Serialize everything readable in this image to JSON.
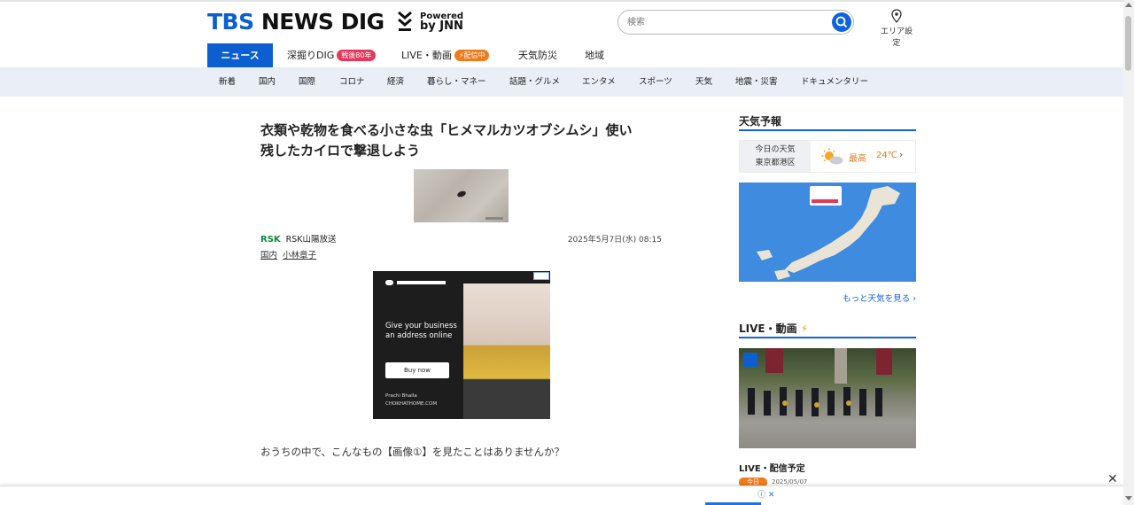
{
  "header": {
    "logo_tbs": "TBS",
    "logo_rest": " NEWS DIG",
    "powered_line1": "Powered",
    "powered_line2": "by JNN",
    "search_placeholder": "検索",
    "area_label": "エリア設定"
  },
  "nav": {
    "items": [
      {
        "label": "ニュース"
      },
      {
        "label": "深掘りDIG",
        "badge": "戦後80年"
      },
      {
        "label": "LIVE・動画",
        "badge": "配信中"
      },
      {
        "label": "天気防災"
      },
      {
        "label": "地域"
      }
    ]
  },
  "subnav": [
    "新着",
    "国内",
    "国際",
    "コロナ",
    "経済",
    "暮らし・マネー",
    "話題・グルメ",
    "エンタメ",
    "スポーツ",
    "天気",
    "地震・災害",
    "ドキュメンタリー"
  ],
  "article": {
    "title_line1": "衣類や乾物を食べる小さな虫「ヒメマルカツオブシムシ」使い",
    "title_line2": "残したカイロで撃退しよう",
    "source_logo": "RSK",
    "source_name": "RSK山陽放送",
    "date": "2025年5月7日(水) 08:15",
    "tags": [
      "国内",
      "小林章子"
    ],
    "lead": "おうちの中で、こんなもの【画像①】を見たことはありませんか？"
  },
  "ad": {
    "text_line1": "Give your business",
    "text_line2": "an address online",
    "button": "Buy now",
    "credit_name": "Prachi Bhalla",
    "credit_url": "CHOKHATHOME.COM"
  },
  "sidebar": {
    "weather_heading": "天気予報",
    "weather_today": "今日の天気",
    "weather_place": "東京都港区",
    "weather_max_label": "最高",
    "weather_max_temp": "24℃",
    "more_weather": "もっと天気を見る ›",
    "live_heading": "LIVE・動画",
    "live_schedule": "LIVE・配信予定",
    "today_badge": "今日",
    "today_date": "2025/05/07"
  },
  "colors": {
    "brand_blue": "#0b5fd1",
    "badge_red": "#e8385a",
    "badge_orange": "#f07b1c"
  }
}
